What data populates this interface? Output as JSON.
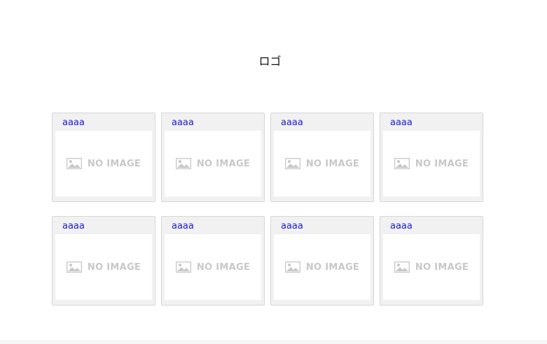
{
  "header": {
    "logo_text": "ロゴ"
  },
  "cards": [
    {
      "title": "aaaa",
      "image_placeholder": "NO IMAGE",
      "icon": "image-placeholder-icon"
    },
    {
      "title": "aaaa",
      "image_placeholder": "NO IMAGE",
      "icon": "image-placeholder-icon"
    },
    {
      "title": "aaaa",
      "image_placeholder": "NO IMAGE",
      "icon": "image-placeholder-icon"
    },
    {
      "title": "aaaa",
      "image_placeholder": "NO IMAGE",
      "icon": "image-placeholder-icon"
    },
    {
      "title": "aaaa",
      "image_placeholder": "NO IMAGE",
      "icon": "image-placeholder-icon"
    },
    {
      "title": "aaaa",
      "image_placeholder": "NO IMAGE",
      "icon": "image-placeholder-icon"
    },
    {
      "title": "aaaa",
      "image_placeholder": "NO IMAGE",
      "icon": "image-placeholder-icon"
    },
    {
      "title": "aaaa",
      "image_placeholder": "NO IMAGE",
      "icon": "image-placeholder-icon"
    }
  ],
  "colors": {
    "link": "#1a1adc",
    "card_background": "#f1f1f1",
    "card_border": "#d6d6d6",
    "placeholder_text": "#c8c8c8"
  }
}
